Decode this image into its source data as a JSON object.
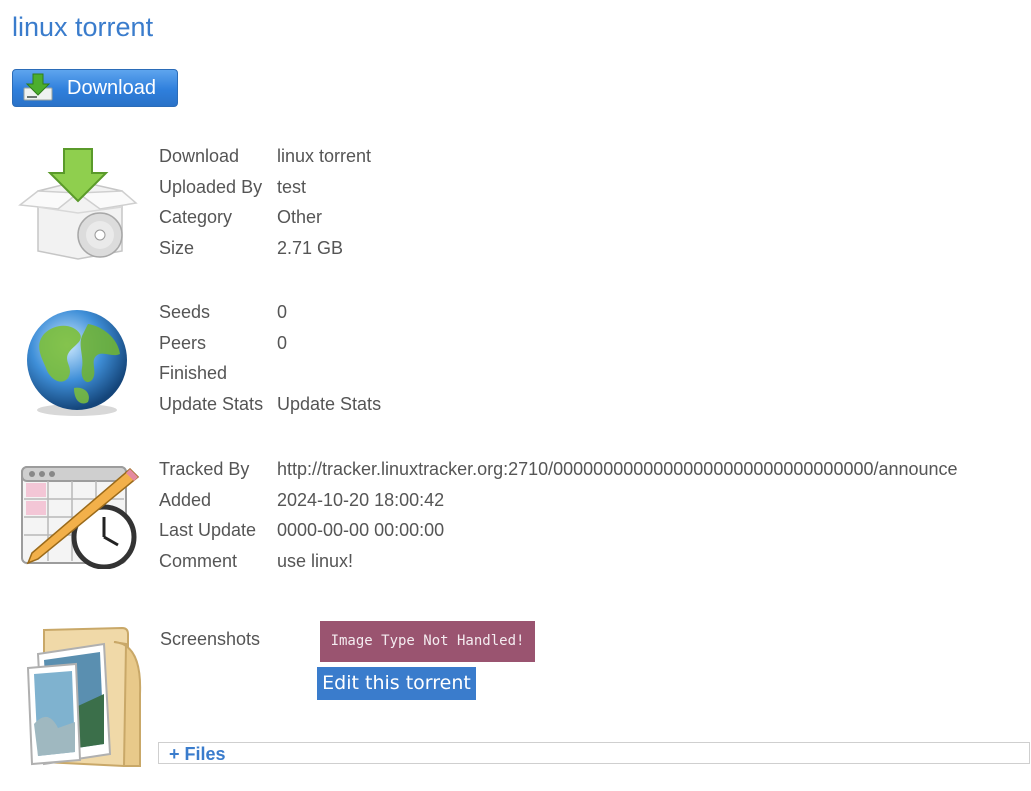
{
  "page_title": "linux torrent",
  "download_button": {
    "label": "Download",
    "icon": "download-box-icon"
  },
  "general_section": {
    "icon": "software-box-download-icon",
    "rows": [
      {
        "label": "Download",
        "value": "linux torrent",
        "link": true
      },
      {
        "label": "Uploaded By",
        "value": "test",
        "link": true
      },
      {
        "label": "Category",
        "value": "Other",
        "link": false
      },
      {
        "label": "Size",
        "value": "2.71 GB",
        "link": false
      }
    ]
  },
  "stats_section": {
    "icon": "globe-icon",
    "rows": [
      {
        "label": "Seeds",
        "value": "0",
        "link": false
      },
      {
        "label": "Peers",
        "value": "0",
        "link": false
      },
      {
        "label": "Finished",
        "value": "",
        "link": false
      },
      {
        "label": "Update Stats",
        "value": "Update Stats",
        "link": true
      }
    ]
  },
  "tracker_section": {
    "icon": "calendar-clock-icon",
    "rows": [
      {
        "label": "Tracked By",
        "value": "http://tracker.linuxtracker.org:2710/00000000000000000000000000000000/announce",
        "link": false
      },
      {
        "label": "Added",
        "value": "2024-10-20 18:00:42",
        "link": false
      },
      {
        "label": "Last Update",
        "value": "0000-00-00 00:00:00",
        "link": false
      },
      {
        "label": "Comment",
        "value": "use linux!",
        "link": false
      }
    ]
  },
  "screenshots_section": {
    "icon": "folder-images-icon",
    "label": "Screenshots",
    "placeholder_text": "Image Type Not Handled!",
    "edit_button": "Edit this torrent"
  },
  "files_toggle": "+ Files",
  "colors": {
    "link": "#3a7ccc",
    "text": "#555555",
    "placeholder_bg": "#9a5470",
    "button_bg": "#3a7ccc"
  }
}
